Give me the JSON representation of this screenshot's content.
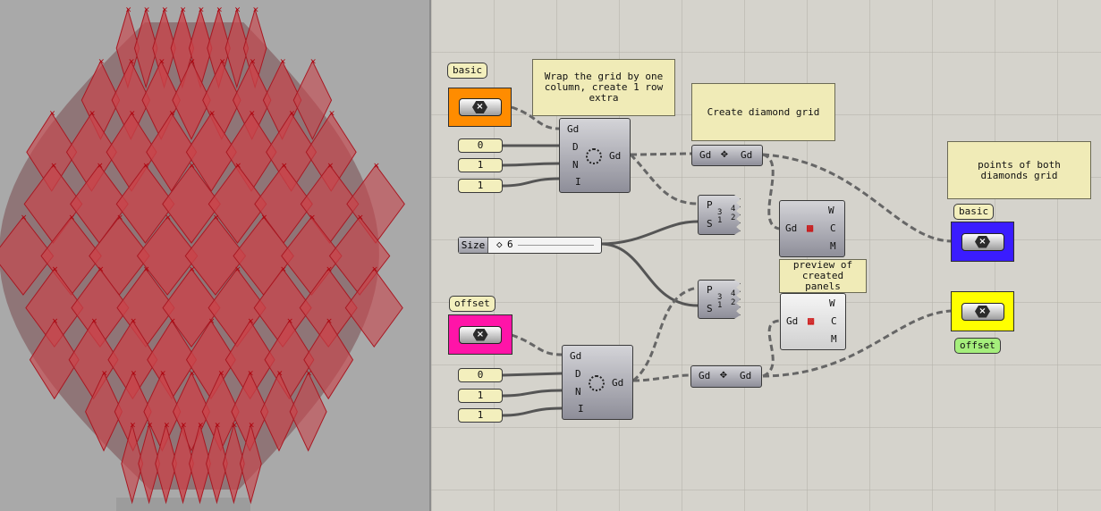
{
  "colors": {
    "viewport_bg": "#a9a9a9",
    "canvas_bg": "#d5d3cc",
    "mesh_fill": "#c9444a",
    "mesh_stroke": "#a81822",
    "orange_param": "#ff8c00",
    "magenta_param": "#ff14a8",
    "blue_param": "#3a1cff",
    "yellow_param": "#ffff00"
  },
  "canvas": {
    "tags": {
      "basic_top": "basic",
      "offset_left": "offset",
      "basic_right": "basic",
      "offset_right": "offset"
    },
    "notes": {
      "wrap": "Wrap the grid by one column, create 1 row extra",
      "diamond": "Create diamond grid",
      "points": "points of both diamonds grid",
      "preview": "preview of created panels"
    },
    "params": {
      "param_icon": "x-hexagon-icon",
      "orange": "×",
      "magenta": "×",
      "blue": "×",
      "yellow": "×"
    },
    "numbers": {
      "top": [
        "0",
        "1",
        "1"
      ],
      "bottom": [
        "0",
        "1",
        "1"
      ]
    },
    "slider": {
      "label": "Size",
      "value": "6"
    },
    "components": {
      "wrap_top": {
        "inputs": [
          "Gd",
          "D",
          "N",
          "I"
        ],
        "output": "Gd"
      },
      "wrap_bottom": {
        "inputs": [
          "Gd",
          "D",
          "N",
          "I"
        ],
        "output": "Gd"
      },
      "diamond_top": {
        "input": "Gd",
        "output": "Gd"
      },
      "diamond_bottom": {
        "input": "Gd",
        "output": "Gd"
      },
      "split_top": {
        "inputs": [
          "P",
          "S"
        ],
        "glyph": [
          "3",
          "4",
          "1",
          "2"
        ]
      },
      "split_bottom": {
        "inputs": [
          "P",
          "S"
        ],
        "glyph": [
          "3",
          "4",
          "1",
          "2"
        ]
      },
      "preview_top": {
        "input": "Gd",
        "outputs": [
          "W",
          "C",
          "M"
        ]
      },
      "preview_bottom": {
        "input": "Gd",
        "outputs": [
          "W",
          "C",
          "M"
        ]
      }
    }
  }
}
